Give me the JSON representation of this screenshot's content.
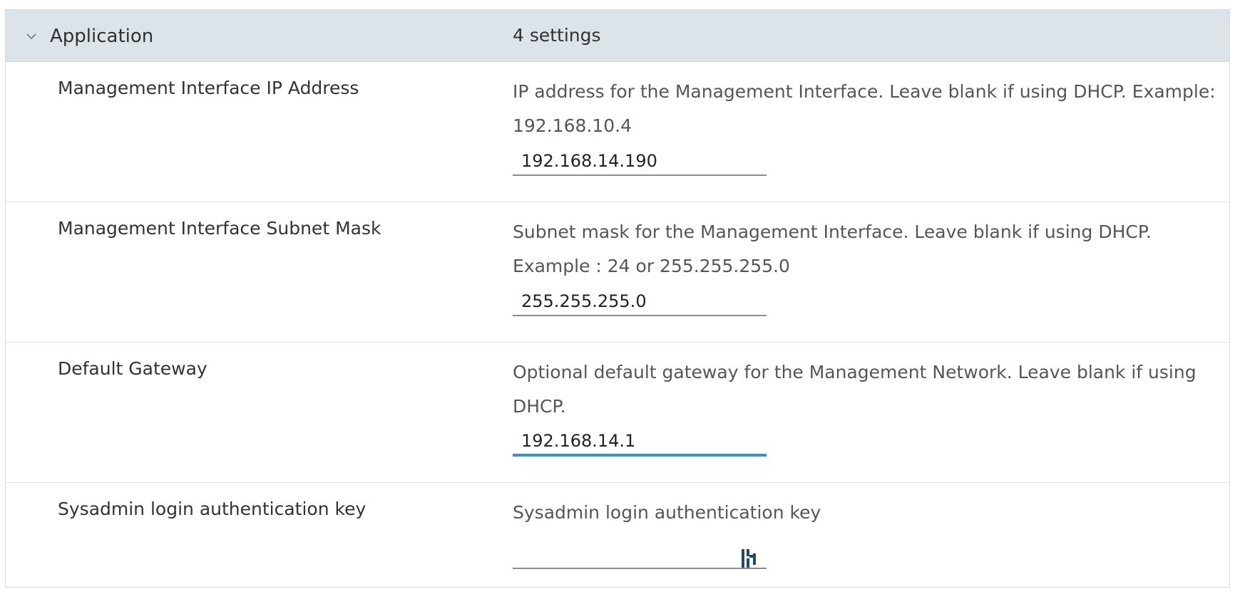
{
  "group": {
    "title": "Application",
    "count": "4 settings",
    "icon": "chevron-down-icon"
  },
  "settings": [
    {
      "label": "Management Interface IP Address",
      "description": "IP address for the Management Interface. Leave blank if using DHCP. Example: 192.168.10.4",
      "value": "192.168.14.190"
    },
    {
      "label": "Management Interface Subnet Mask",
      "description": "Subnet mask for the Management Interface. Leave blank if using DHCP. Example : 24 or 255.255.255.0",
      "value": "255.255.255.0"
    },
    {
      "label": "Default Gateway",
      "description": "Optional default gateway for the Management Network. Leave blank if using DHCP.",
      "value": "192.168.14.1"
    },
    {
      "label": "Sysadmin login authentication key",
      "description": "Sysadmin login authentication key",
      "value": "",
      "icon": "password-manager-icon"
    }
  ],
  "colors": {
    "header_bg": "#dde4e9",
    "active_underline": "#3d8fd6",
    "icon": "#1f4a63"
  }
}
